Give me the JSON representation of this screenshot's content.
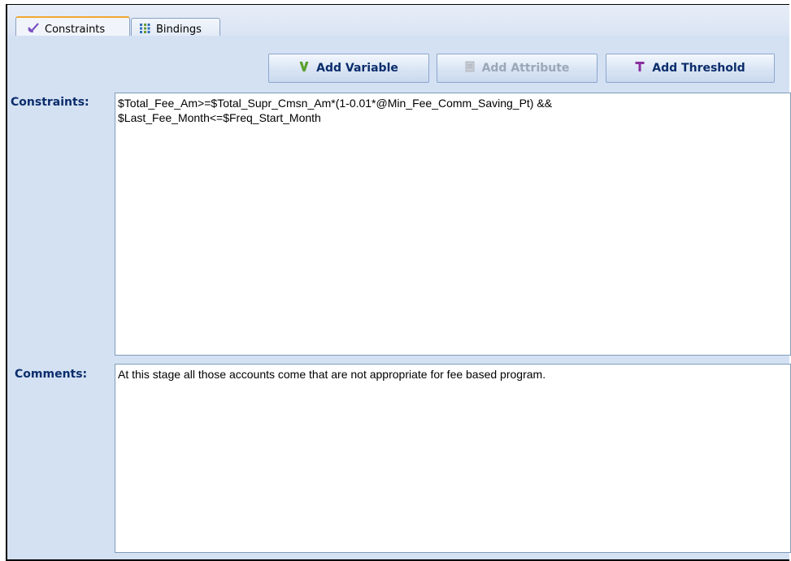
{
  "tabs": [
    {
      "label": "Constraints",
      "icon": "check-icon",
      "active": true
    },
    {
      "label": "Bindings",
      "icon": "bindings-grid-icon",
      "active": false
    }
  ],
  "toolbar": {
    "add_variable": {
      "label": "Add Variable",
      "icon": "variable-v-icon",
      "enabled": true
    },
    "add_attribute": {
      "label": "Add Attribute",
      "icon": "attribute-icon",
      "enabled": false
    },
    "add_threshold": {
      "label": "Add Threshold",
      "icon": "threshold-t-icon",
      "enabled": true
    }
  },
  "constraints": {
    "label": "Constraints:",
    "value": "$Total_Fee_Am>=$Total_Supr_Cmsn_Am*(1-0.01*@Min_Fee_Comm_Saving_Pt) &&\n$Last_Fee_Month<=$Freq_Start_Month"
  },
  "comments": {
    "label": "Comments:",
    "value": "At this stage all those accounts come that are not appropriate for fee based program."
  },
  "colors": {
    "panel_bg": "#d3e1f3",
    "label_text": "#0b2d6b",
    "active_tab_accent": "#f0a830",
    "variable_icon": "#5aa02c",
    "threshold_icon": "#8a2f9e"
  }
}
